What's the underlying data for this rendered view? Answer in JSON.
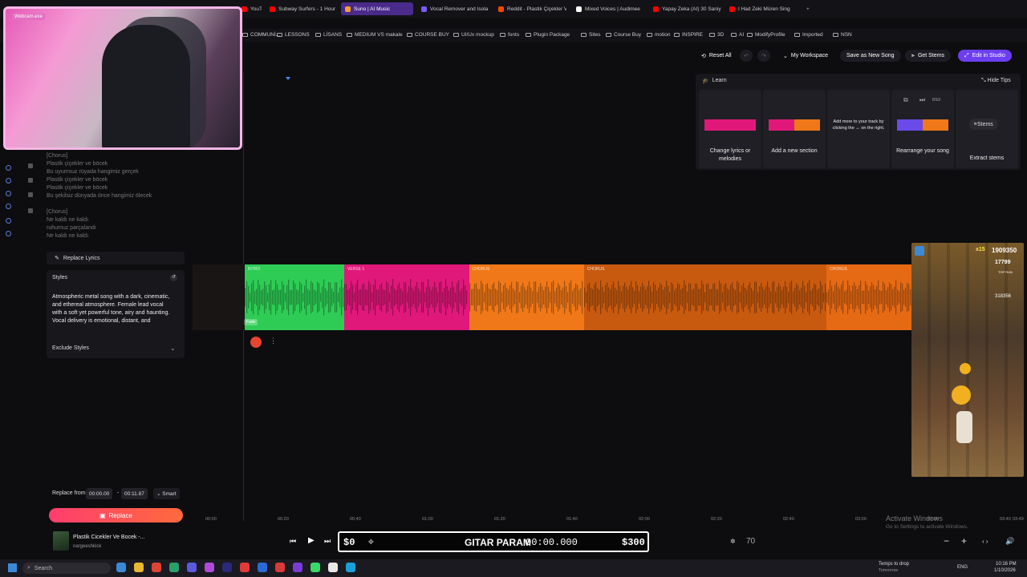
{
  "browser": {
    "tabs": [
      {
        "label": "YouTube",
        "color": "#ff0000"
      },
      {
        "label": "Subway Surfers - 1 Hour",
        "color": "#ff0000"
      },
      {
        "label": "Suno | AI Music",
        "color": "#f0a030",
        "active": true
      },
      {
        "label": "Vocal Remover and Isola",
        "color": "#7a5af8"
      },
      {
        "label": "Reddit - Plastik Çiçekler Ve",
        "color": "#ff4500"
      },
      {
        "label": "Mixed Voices | Audimee",
        "color": "#ffffff"
      },
      {
        "label": "Yapay Zeka (AI) 30 Saniy",
        "color": "#ff0000"
      },
      {
        "label": "I Had Zeki Müren Sing",
        "color": "#ff0000"
      }
    ],
    "bookmarks": [
      "COMMUNİ...",
      "LESSONS",
      "LİSANS",
      "MEDIUM VS makale",
      "COURSE BUY",
      "UI/Ux mockup",
      "fonts",
      "Plugin Package",
      "Sites",
      "Course Buy",
      "motion",
      "INSPIRE",
      "3D",
      "AI",
      "ModifyProfile",
      "Imported",
      "NSN"
    ]
  },
  "webcam": {
    "label": "Webcam.exe"
  },
  "toolbar": {
    "reset_all": "Reset All",
    "workspace": "My Workspace",
    "save_new": "Save as New Song",
    "get_stems": "Get Stems",
    "edit_studio": "Edit in Studio"
  },
  "tips": {
    "title": "Learn",
    "hide": "Hide Tips",
    "cards": [
      {
        "label": "Change lyrics or melodies"
      },
      {
        "label": "Add a new section"
      },
      {
        "label": "Add more to your track by clicking the ↔ on the right."
      },
      {
        "label": "Rearrange your song"
      },
      {
        "label": "Extract stems",
        "button": "Stems"
      }
    ],
    "rsx": "RSX"
  },
  "lyrics": {
    "lines": [
      "[Chorus]",
      "Plastik çiçekler ve böcek",
      "Bu uyumsuz rüyada hangimiz gerçek",
      "Plastik çiçekler ve böcek",
      "Plastik çiçekler ve böcek",
      "Bu şekilsiz dünyada önce hangimiz ölecek",
      "",
      "[Chorus]",
      "Ne kaldı ne kaldı",
      "ruhumuz parçalandı",
      "Ne kaldı ne kaldı"
    ],
    "replace_label": "Replace Lyrics"
  },
  "styles": {
    "title": "Styles",
    "text": "Atmospheric metal song with a dark, cinematic, and ethereal atmosphere. Female lead vocal with a soft yet powerful tone, airy and haunting. Vocal delivery is emotional, distant, and",
    "exclude": "Exclude Styles"
  },
  "replace": {
    "from_label": "Replace from",
    "start": "00:00.00",
    "dash": "-",
    "end": "00:11.87",
    "mode": "Smart",
    "button": "Replace"
  },
  "timeline": {
    "sections": [
      {
        "label": "INTRO",
        "color": "#2ecc55",
        "start": 0.072,
        "end": 0.21
      },
      {
        "label": "VERSE 1",
        "color": "#e0187a",
        "start": 0.21,
        "end": 0.383
      },
      {
        "label": "CHORUS",
        "color": "#f07818",
        "start": 0.383,
        "end": 0.542
      },
      {
        "label": "CHORUS",
        "color": "#c85a10",
        "start": 0.542,
        "end": 0.878
      },
      {
        "label": "CHORUS",
        "color": "#e66a14",
        "start": 0.878,
        "end": 1.0
      }
    ],
    "fade_label": "Fade",
    "ticks": [
      "00:00",
      "00:20",
      "00:40",
      "01:00",
      "01:20",
      "01:40",
      "02:00",
      "02:20",
      "02:40",
      "03:00",
      "03:20",
      "03:40",
      "03:49"
    ]
  },
  "player": {
    "title": "Plastik Cicekler Ve Bocek -...",
    "artist": "nargeeshkick",
    "volume": "70"
  },
  "game_bar": {
    "left": "$0",
    "name": "GITAR PARAM",
    "timer": "00:00.000",
    "right": "$300"
  },
  "subway": {
    "score": "1909350",
    "coins": "17799",
    "multiplier": "x15",
    "extra": "318356",
    "top_run": "TOP RUN"
  },
  "windows_activate": {
    "title": "Activate Windows",
    "subtitle": "Go to Settings to activate Windows."
  },
  "taskbar": {
    "search": "Search",
    "weather": "Temps to drop",
    "weather_sub": "Tomorrow",
    "lang": "ENG",
    "time": "10:16 PM",
    "date": "1/10/2026"
  }
}
